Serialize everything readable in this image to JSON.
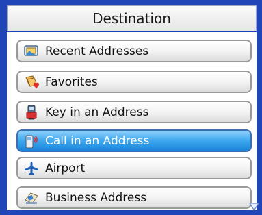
{
  "header": {
    "title": "Destination"
  },
  "menu": {
    "items": [
      {
        "label": "Recent Addresses",
        "icon": "recent-addresses-icon",
        "selected": false
      },
      {
        "label": "Favorites",
        "icon": "favorites-icon",
        "selected": false
      },
      {
        "label": "Key in an Address",
        "icon": "keypad-phone-icon",
        "selected": false
      },
      {
        "label": "Call in an Address",
        "icon": "mobile-phone-call-icon",
        "selected": true
      },
      {
        "label": "Airport",
        "icon": "airplane-icon",
        "selected": false
      },
      {
        "label": "Business Address",
        "icon": "business-address-icon",
        "selected": false
      }
    ]
  },
  "colors": {
    "frame": "#1f45b8",
    "selected_item": "#3ea7ef",
    "item_border": "#9a9a9a"
  }
}
